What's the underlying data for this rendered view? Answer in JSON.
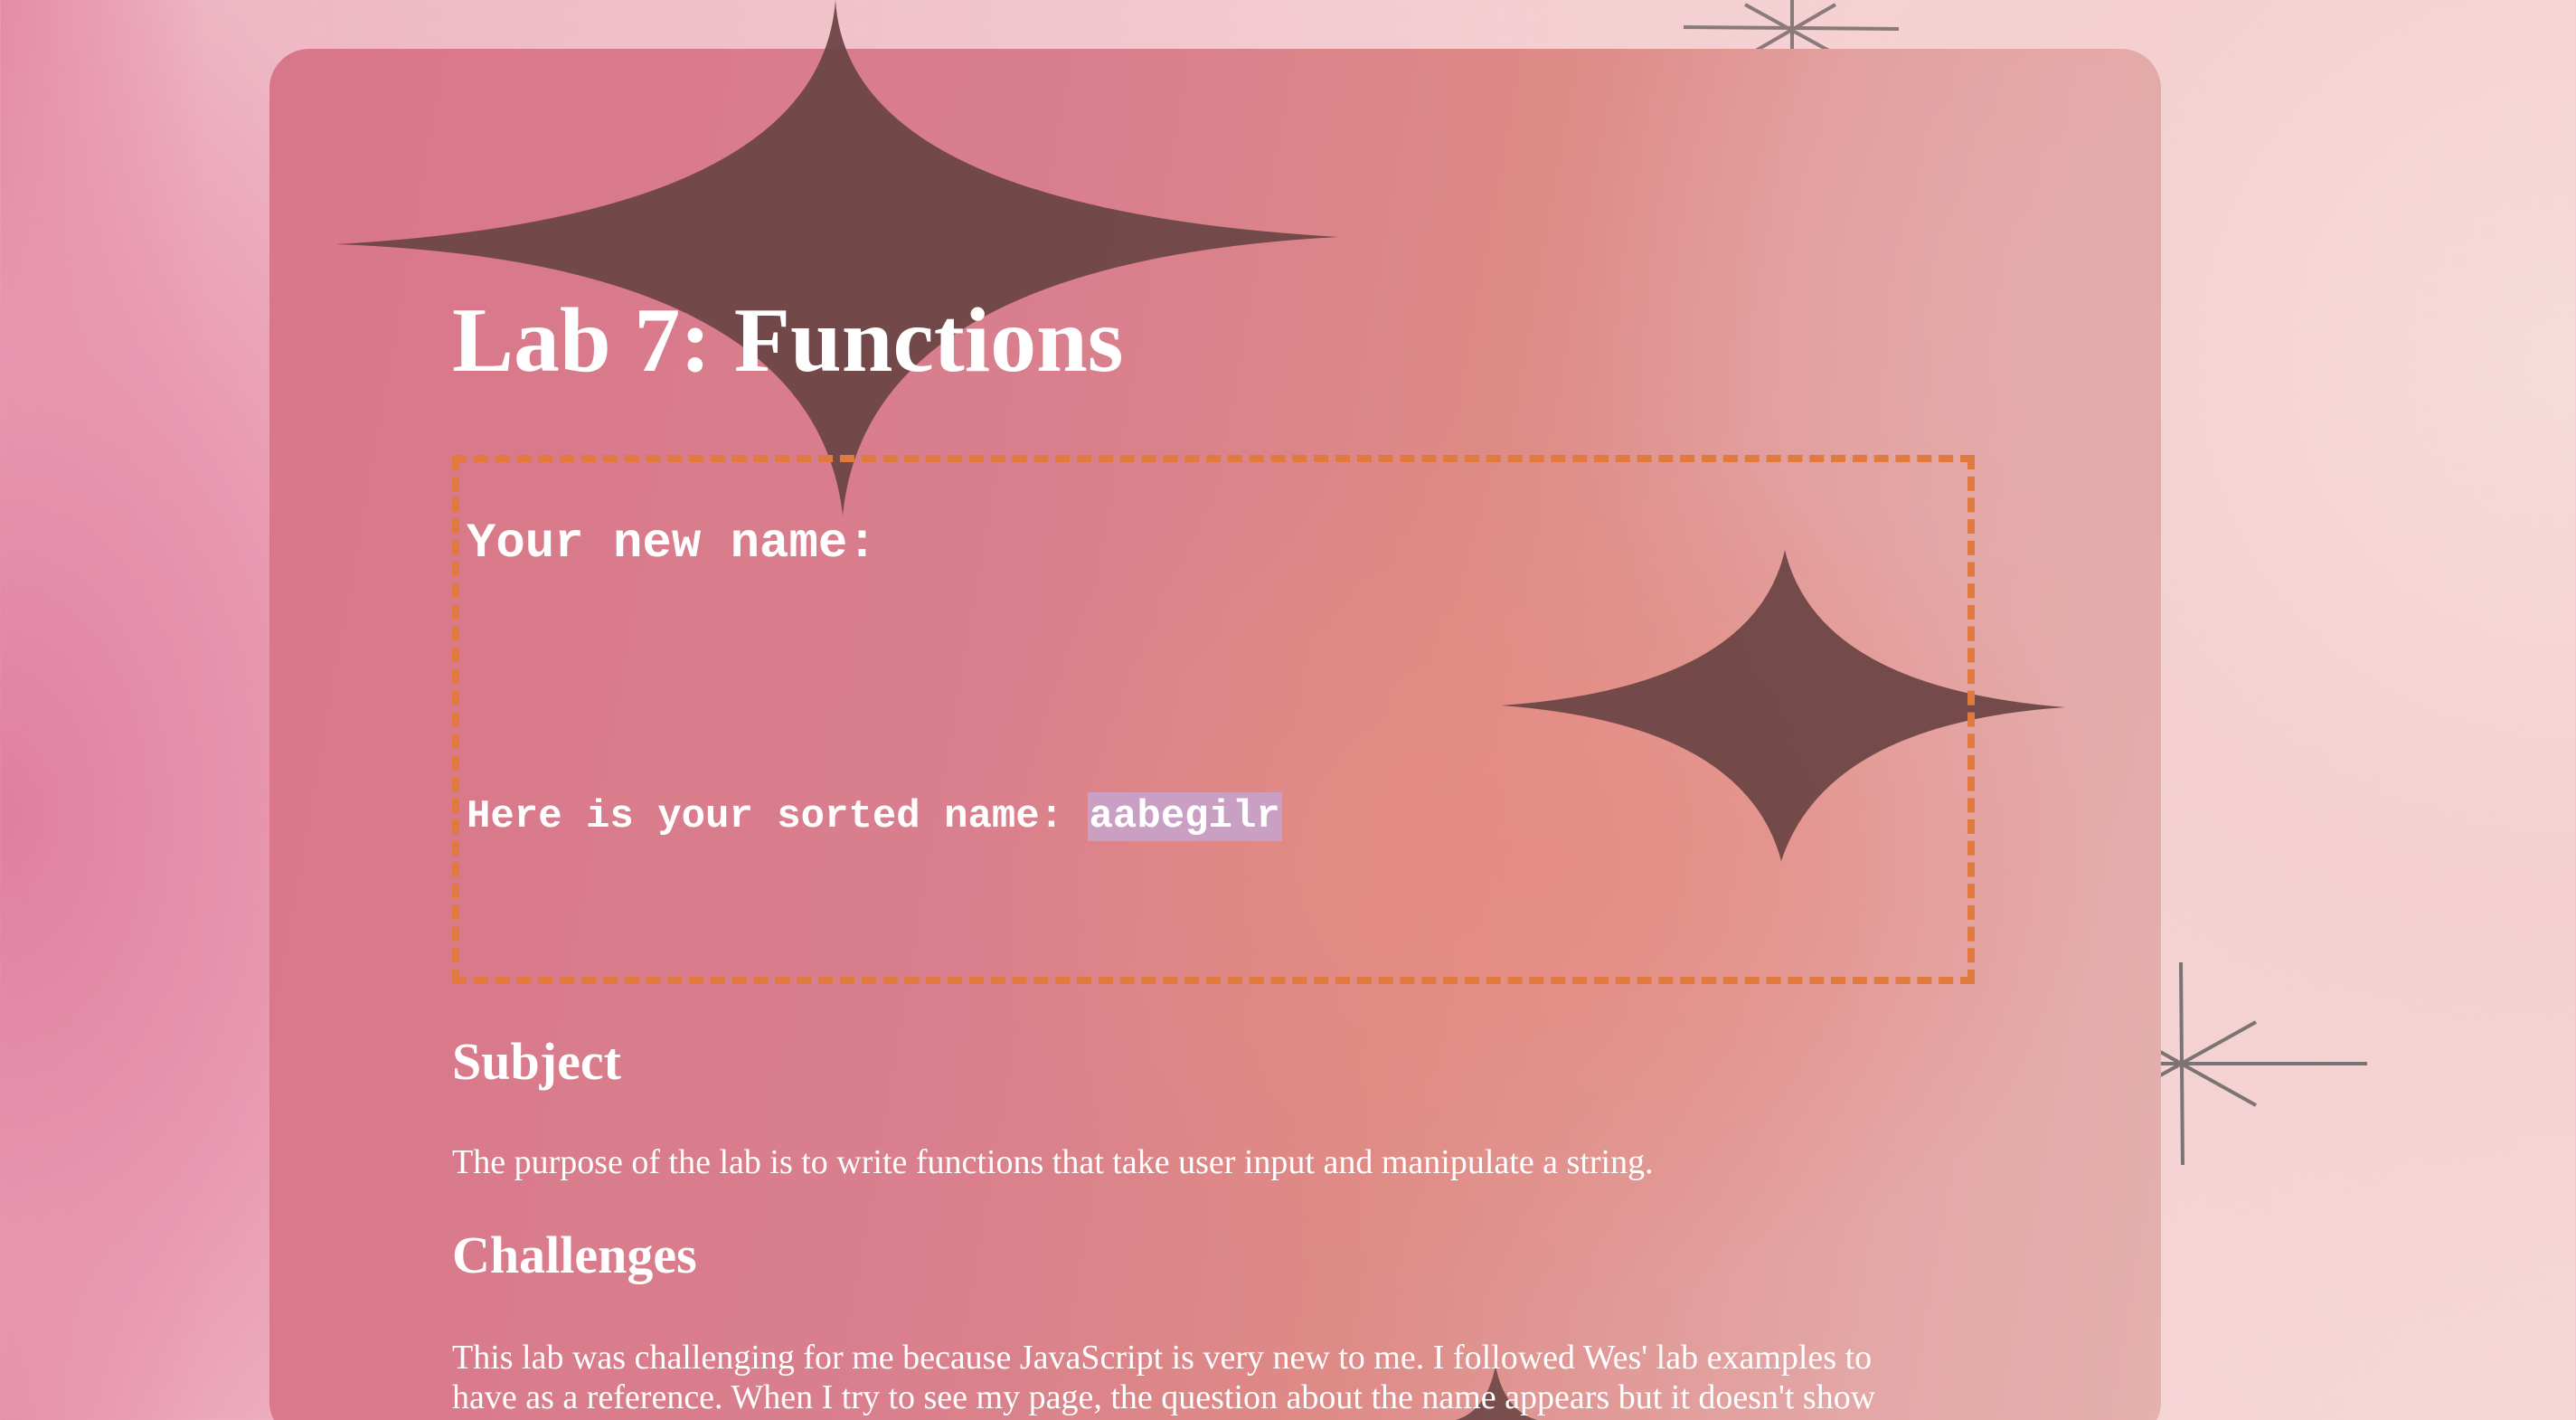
{
  "page": {
    "title": "Lab 7: Functions"
  },
  "name_box": {
    "heading": "Your new name:",
    "sorted_label": "Here is your sorted name:",
    "sorted_value": "aabegilr"
  },
  "sections": {
    "subject": {
      "heading": "Subject",
      "text": "The purpose of the lab is to write functions that take user input and manipulate a string."
    },
    "challenges": {
      "heading": "Challenges",
      "line1": "This lab was challenging for me because JavaScript is very new to me. I followed Wes' lab examples to",
      "line2": "have as a reference. When I try to see my page, the question about the name appears but it doesn't show"
    }
  },
  "colors": {
    "panel_pink": "#d97f8d",
    "box_border": "#e07a3e",
    "sparkle": "#6e4444",
    "highlight": "#c9a0c4"
  }
}
